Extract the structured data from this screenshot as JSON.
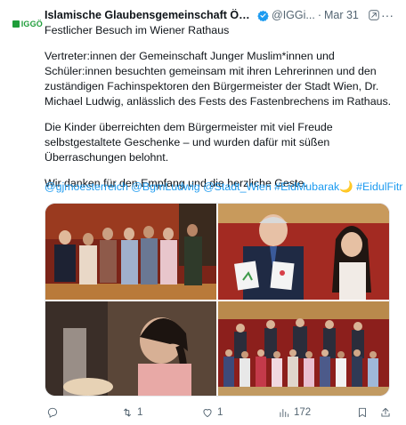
{
  "author": {
    "logo_text": "IGGÖ",
    "display_name": "Islamische Glaubensgemeinschaft Österre...",
    "handle": "@IGGi...",
    "separator": "·",
    "date": "Mar 31"
  },
  "tweet": {
    "title_line": "Festlicher Besuch im Wiener Rathaus",
    "paragraph1": "Vertreter:innen der Gemeinschaft Junger Muslim*innen und Schüler:innen besuchten gemeinsam mit ihren Lehrerinnen und den zuständigen Fachinspektoren den Bürgermeister der Stadt Wien, Dr. Michael Ludwig, anlässlich des Fests des Fastenbrechens im Rathaus.",
    "paragraph2": "Die Kinder überreichten dem Bürgermeister mit viel Freude selbstgestaltete Geschenke – und wurden dafür mit süßen Überraschungen belohnt.",
    "paragraph3": "Wir danken für den Empfang und die herzliche Geste.",
    "hashtags": [
      "@gjmoesterreich",
      "@BgmLudwig",
      "@Stadt_Wien",
      "#EidMubarak",
      "🌙",
      "#EidulFitr"
    ]
  },
  "actions": {
    "replies": "",
    "reposts": "1",
    "likes": "1",
    "views": "172"
  },
  "colors": {
    "link": "#1d9bf0",
    "muted": "#536471",
    "brand": "#1f9d3a",
    "verified": "#1d9bf0"
  },
  "icons": [
    "verified-badge-icon",
    "more-options-icon",
    "grok-icon",
    "reply-icon",
    "repost-icon",
    "like-icon",
    "views-icon",
    "bookmark-icon",
    "share-icon"
  ]
}
